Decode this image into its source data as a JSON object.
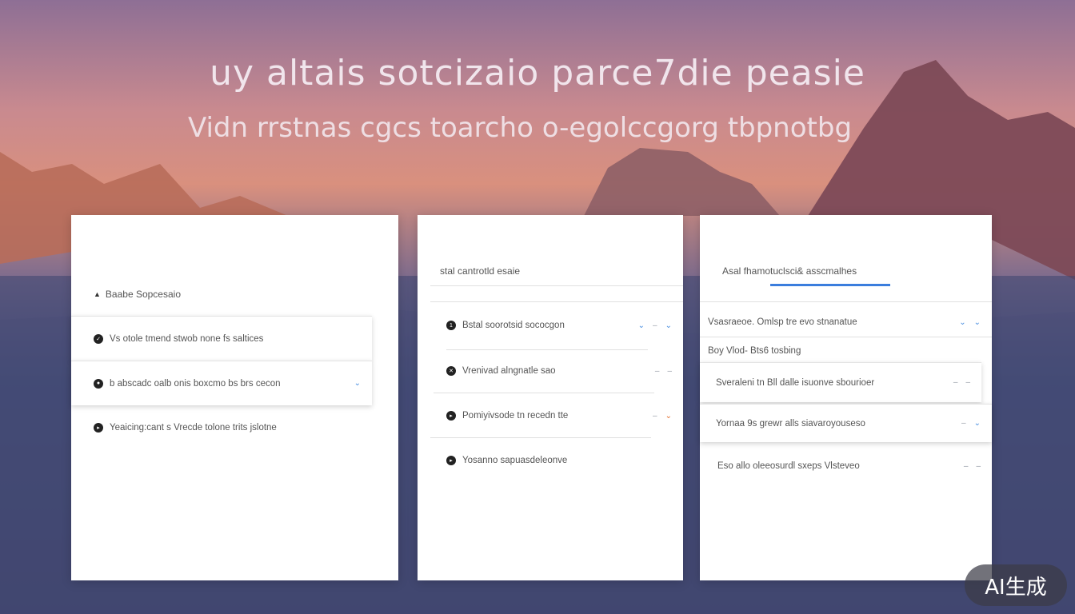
{
  "hero": {
    "title": "uy altais sotcizaio parce7die peasie",
    "subtitle": "Vidn rrstnas cgcs toarcho o-egolccgorg tbpnotbg"
  },
  "panel1": {
    "header": "Baabe Sopcesaio",
    "rows": [
      "Vs otole tmend stwob none fs saltices",
      "b abscadc oalb onis boxcmo bs brs cecon",
      "Yeaicing:cant s Vrecde tolone trits jslotne"
    ]
  },
  "panel2": {
    "header": "stal cantrotld esaie",
    "rows": [
      "Bstal soorotsid sococgon",
      "Vrenivad alngnatle sao",
      "Pomiyivsode tn recedn tte",
      "Yosanno sapuasdeleonve"
    ]
  },
  "panel3": {
    "header": "Asal fhamotuclsci& asscmalhes",
    "rows": [
      "Vsasraeoe. Omlsp tre evo stnanatue",
      "Boy Vlod- Bts6 tosbing",
      "Sveraleni tn Bll dalle isuonve sbourioer",
      "Yornaa 9s grewr alls siavaroyouseso",
      "Eso allo oleeosurdl sxeps Vlsteveo"
    ]
  },
  "badge": "AI生成"
}
